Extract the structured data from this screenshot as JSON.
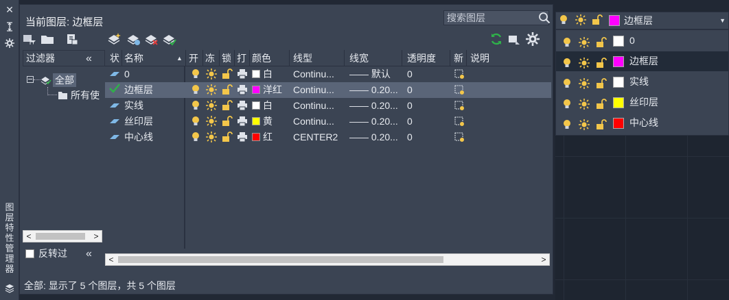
{
  "strip": {
    "vertical_title": "图层特性管理器"
  },
  "palette": {
    "current_layer_label": "当前图层: 边框层",
    "search_placeholder": "搜索图层"
  },
  "filter": {
    "header": "过滤器",
    "tree_all": "全部",
    "tree_used": "所有使",
    "invert_label": "反转过"
  },
  "grid": {
    "columns": [
      "状",
      "名称",
      "开",
      "冻",
      "锁",
      "打",
      "颜色",
      "线型",
      "线宽",
      "透明度",
      "新",
      "说明"
    ],
    "rows": [
      {
        "name": "0",
        "color_name": "白",
        "color": "#ffffff",
        "linetype": "Continu...",
        "lineweight": "—— 默认",
        "transparency": "0",
        "current": false,
        "selected": false
      },
      {
        "name": "边框层",
        "color_name": "洋红",
        "color": "#ff00ff",
        "linetype": "Continu...",
        "lineweight": "—— 0.20...",
        "transparency": "0",
        "current": true,
        "selected": true
      },
      {
        "name": "实线",
        "color_name": "白",
        "color": "#ffffff",
        "linetype": "Continu...",
        "lineweight": "—— 0.20...",
        "transparency": "0",
        "current": false,
        "selected": false
      },
      {
        "name": "丝印层",
        "color_name": "黄",
        "color": "#ffff00",
        "linetype": "Continu...",
        "lineweight": "—— 0.20...",
        "transparency": "0",
        "current": false,
        "selected": false
      },
      {
        "name": "中心线",
        "color_name": "红",
        "color": "#ff0000",
        "linetype": "CENTER2",
        "lineweight": "—— 0.20...",
        "transparency": "0",
        "current": false,
        "selected": false
      }
    ]
  },
  "status_text": "全部: 显示了 5 个图层，共 5 个图层",
  "dropdown": {
    "selected_layer": "边框层",
    "selected_color": "#ff00ff",
    "items": [
      {
        "label": "0",
        "color": "#ffffff"
      },
      {
        "label": "边框层",
        "color": "#ff00ff"
      },
      {
        "label": "实线",
        "color": "#ffffff"
      },
      {
        "label": "丝印层",
        "color": "#ffff00"
      },
      {
        "label": "中心线",
        "color": "#ff0000"
      }
    ]
  },
  "colors": {
    "panel_bg": "#3b4453",
    "selected_row": "#5a6578",
    "bulb": "#f3c64a",
    "sun": "#f3c64a",
    "refresh_green": "#2fb24a"
  }
}
